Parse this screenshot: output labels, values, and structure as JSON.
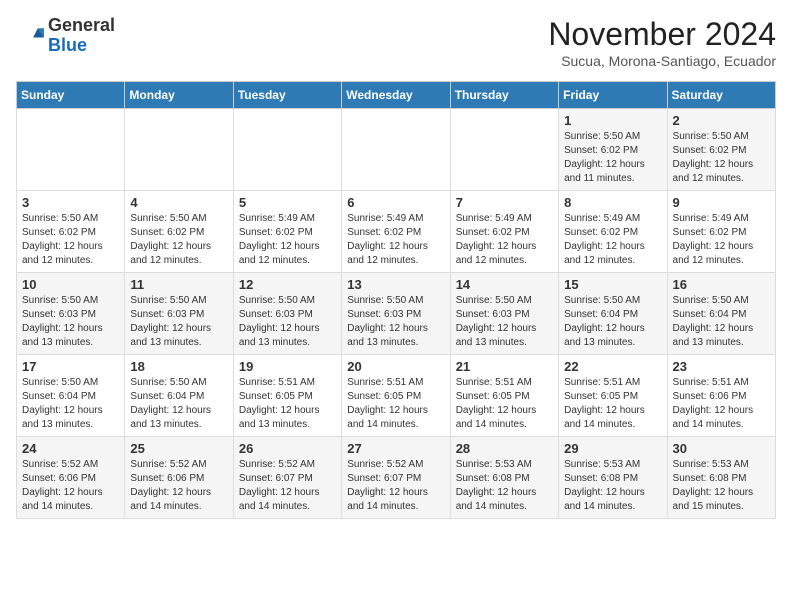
{
  "header": {
    "logo_general": "General",
    "logo_blue": "Blue",
    "month_title": "November 2024",
    "subtitle": "Sucua, Morona-Santiago, Ecuador"
  },
  "weekdays": [
    "Sunday",
    "Monday",
    "Tuesday",
    "Wednesday",
    "Thursday",
    "Friday",
    "Saturday"
  ],
  "weeks": [
    [
      {
        "day": "",
        "info": ""
      },
      {
        "day": "",
        "info": ""
      },
      {
        "day": "",
        "info": ""
      },
      {
        "day": "",
        "info": ""
      },
      {
        "day": "",
        "info": ""
      },
      {
        "day": "1",
        "info": "Sunrise: 5:50 AM\nSunset: 6:02 PM\nDaylight: 12 hours\nand 11 minutes."
      },
      {
        "day": "2",
        "info": "Sunrise: 5:50 AM\nSunset: 6:02 PM\nDaylight: 12 hours\nand 12 minutes."
      }
    ],
    [
      {
        "day": "3",
        "info": "Sunrise: 5:50 AM\nSunset: 6:02 PM\nDaylight: 12 hours\nand 12 minutes."
      },
      {
        "day": "4",
        "info": "Sunrise: 5:50 AM\nSunset: 6:02 PM\nDaylight: 12 hours\nand 12 minutes."
      },
      {
        "day": "5",
        "info": "Sunrise: 5:49 AM\nSunset: 6:02 PM\nDaylight: 12 hours\nand 12 minutes."
      },
      {
        "day": "6",
        "info": "Sunrise: 5:49 AM\nSunset: 6:02 PM\nDaylight: 12 hours\nand 12 minutes."
      },
      {
        "day": "7",
        "info": "Sunrise: 5:49 AM\nSunset: 6:02 PM\nDaylight: 12 hours\nand 12 minutes."
      },
      {
        "day": "8",
        "info": "Sunrise: 5:49 AM\nSunset: 6:02 PM\nDaylight: 12 hours\nand 12 minutes."
      },
      {
        "day": "9",
        "info": "Sunrise: 5:49 AM\nSunset: 6:02 PM\nDaylight: 12 hours\nand 12 minutes."
      }
    ],
    [
      {
        "day": "10",
        "info": "Sunrise: 5:50 AM\nSunset: 6:03 PM\nDaylight: 12 hours\nand 13 minutes."
      },
      {
        "day": "11",
        "info": "Sunrise: 5:50 AM\nSunset: 6:03 PM\nDaylight: 12 hours\nand 13 minutes."
      },
      {
        "day": "12",
        "info": "Sunrise: 5:50 AM\nSunset: 6:03 PM\nDaylight: 12 hours\nand 13 minutes."
      },
      {
        "day": "13",
        "info": "Sunrise: 5:50 AM\nSunset: 6:03 PM\nDaylight: 12 hours\nand 13 minutes."
      },
      {
        "day": "14",
        "info": "Sunrise: 5:50 AM\nSunset: 6:03 PM\nDaylight: 12 hours\nand 13 minutes."
      },
      {
        "day": "15",
        "info": "Sunrise: 5:50 AM\nSunset: 6:04 PM\nDaylight: 12 hours\nand 13 minutes."
      },
      {
        "day": "16",
        "info": "Sunrise: 5:50 AM\nSunset: 6:04 PM\nDaylight: 12 hours\nand 13 minutes."
      }
    ],
    [
      {
        "day": "17",
        "info": "Sunrise: 5:50 AM\nSunset: 6:04 PM\nDaylight: 12 hours\nand 13 minutes."
      },
      {
        "day": "18",
        "info": "Sunrise: 5:50 AM\nSunset: 6:04 PM\nDaylight: 12 hours\nand 13 minutes."
      },
      {
        "day": "19",
        "info": "Sunrise: 5:51 AM\nSunset: 6:05 PM\nDaylight: 12 hours\nand 13 minutes."
      },
      {
        "day": "20",
        "info": "Sunrise: 5:51 AM\nSunset: 6:05 PM\nDaylight: 12 hours\nand 14 minutes."
      },
      {
        "day": "21",
        "info": "Sunrise: 5:51 AM\nSunset: 6:05 PM\nDaylight: 12 hours\nand 14 minutes."
      },
      {
        "day": "22",
        "info": "Sunrise: 5:51 AM\nSunset: 6:05 PM\nDaylight: 12 hours\nand 14 minutes."
      },
      {
        "day": "23",
        "info": "Sunrise: 5:51 AM\nSunset: 6:06 PM\nDaylight: 12 hours\nand 14 minutes."
      }
    ],
    [
      {
        "day": "24",
        "info": "Sunrise: 5:52 AM\nSunset: 6:06 PM\nDaylight: 12 hours\nand 14 minutes."
      },
      {
        "day": "25",
        "info": "Sunrise: 5:52 AM\nSunset: 6:06 PM\nDaylight: 12 hours\nand 14 minutes."
      },
      {
        "day": "26",
        "info": "Sunrise: 5:52 AM\nSunset: 6:07 PM\nDaylight: 12 hours\nand 14 minutes."
      },
      {
        "day": "27",
        "info": "Sunrise: 5:52 AM\nSunset: 6:07 PM\nDaylight: 12 hours\nand 14 minutes."
      },
      {
        "day": "28",
        "info": "Sunrise: 5:53 AM\nSunset: 6:08 PM\nDaylight: 12 hours\nand 14 minutes."
      },
      {
        "day": "29",
        "info": "Sunrise: 5:53 AM\nSunset: 6:08 PM\nDaylight: 12 hours\nand 14 minutes."
      },
      {
        "day": "30",
        "info": "Sunrise: 5:53 AM\nSunset: 6:08 PM\nDaylight: 12 hours\nand 15 minutes."
      }
    ]
  ]
}
